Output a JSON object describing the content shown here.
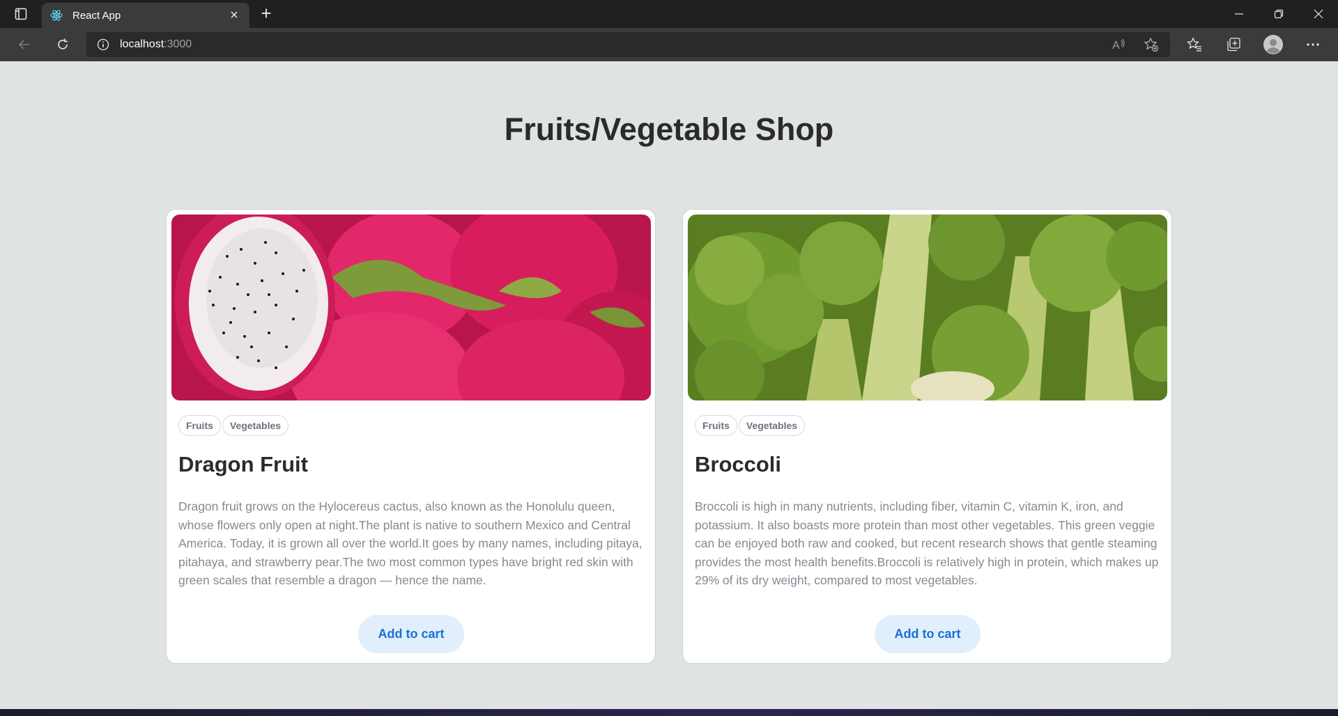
{
  "browser": {
    "tab_title": "React App",
    "new_tab_symbol": "+",
    "close_symbol": "×",
    "address_host": "localhost",
    "address_port": ":3000"
  },
  "page": {
    "title": "Fruits/Vegetable Shop"
  },
  "products": [
    {
      "name": "Dragon Fruit",
      "tags": [
        "Fruits",
        "Vegetables"
      ],
      "description": "Dragon fruit grows on the Hylocereus cactus, also known as the Honolulu queen, whose flowers only open at night.The plant is native to southern Mexico and Central America. Today, it is grown all over the world.It goes by many names, including pitaya, pitahaya, and strawberry pear.The two most common types have bright red skin with green scales that resemble a dragon — hence the name.",
      "button_label": "Add to cart"
    },
    {
      "name": "Broccoli",
      "tags": [
        "Fruits",
        "Vegetables"
      ],
      "description": "Broccoli is high in many nutrients, including fiber, vitamin C, vitamin K, iron, and potassium. It also boasts more protein than most other vegetables. This green veggie can be enjoyed both raw and cooked, but recent research shows that gentle steaming provides the most health benefits.Broccoli is relatively high in protein, which makes up 29% of its dry weight, compared to most vegetables.",
      "button_label": "Add to cart"
    }
  ],
  "colors": {
    "page_bg": "#dfe3e4",
    "button_bg": "#e1effd",
    "button_text": "#1b6fd6",
    "dragon_pink": "#e0205f",
    "broccoli_green": "#6f9a2e"
  }
}
